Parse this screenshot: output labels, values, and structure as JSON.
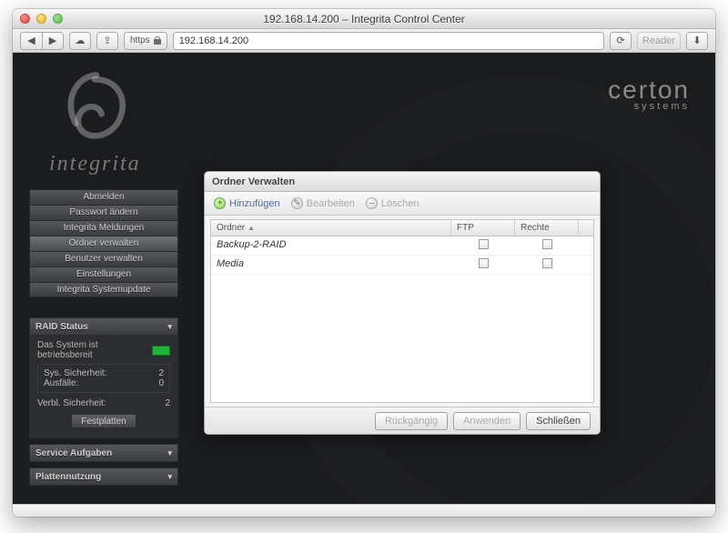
{
  "window": {
    "title": "192.168.14.200 – Integrita Control Center"
  },
  "toolbar": {
    "https_label": "https",
    "url": "192.168.14.200",
    "reader_label": "Reader"
  },
  "branding": {
    "product": "integrita",
    "vendor_big": "certon",
    "vendor_small": "systems"
  },
  "sidebar": {
    "items": [
      {
        "label": "Abmelden"
      },
      {
        "label": "Passwort ändern"
      },
      {
        "label": "Integrita Meldungen"
      },
      {
        "label": "Ordner verwalten"
      },
      {
        "label": "Benutzer verwalten"
      },
      {
        "label": "Einstellungen"
      },
      {
        "label": "Integrita Systemupdate"
      }
    ]
  },
  "raid_panel": {
    "title": "RAID Status",
    "ready_text": "Das System ist betriebsbereit",
    "rows": [
      {
        "k": "Sys. Sicherheit:",
        "v": "2"
      },
      {
        "k": "Ausfälle:",
        "v": "0"
      }
    ],
    "remain": {
      "k": "Verbl. Sicherheit:",
      "v": "2"
    },
    "disk_btn": "Festplatten"
  },
  "extra_panels": [
    {
      "title": "Service Aufgaben"
    },
    {
      "title": "Plattennutzung"
    }
  ],
  "dialog": {
    "title": "Ordner Verwalten",
    "actions": {
      "add": "Hinzufügen",
      "edit": "Bearbeiten",
      "del": "Löschen"
    },
    "columns": {
      "folder": "Ordner",
      "ftp": "FTP",
      "rights": "Rechte"
    },
    "rows": [
      {
        "name": "Backup-2-RAID"
      },
      {
        "name": "Media"
      }
    ],
    "buttons": {
      "undo": "Rückgängig",
      "apply": "Anwenden",
      "close": "Schließen"
    }
  }
}
